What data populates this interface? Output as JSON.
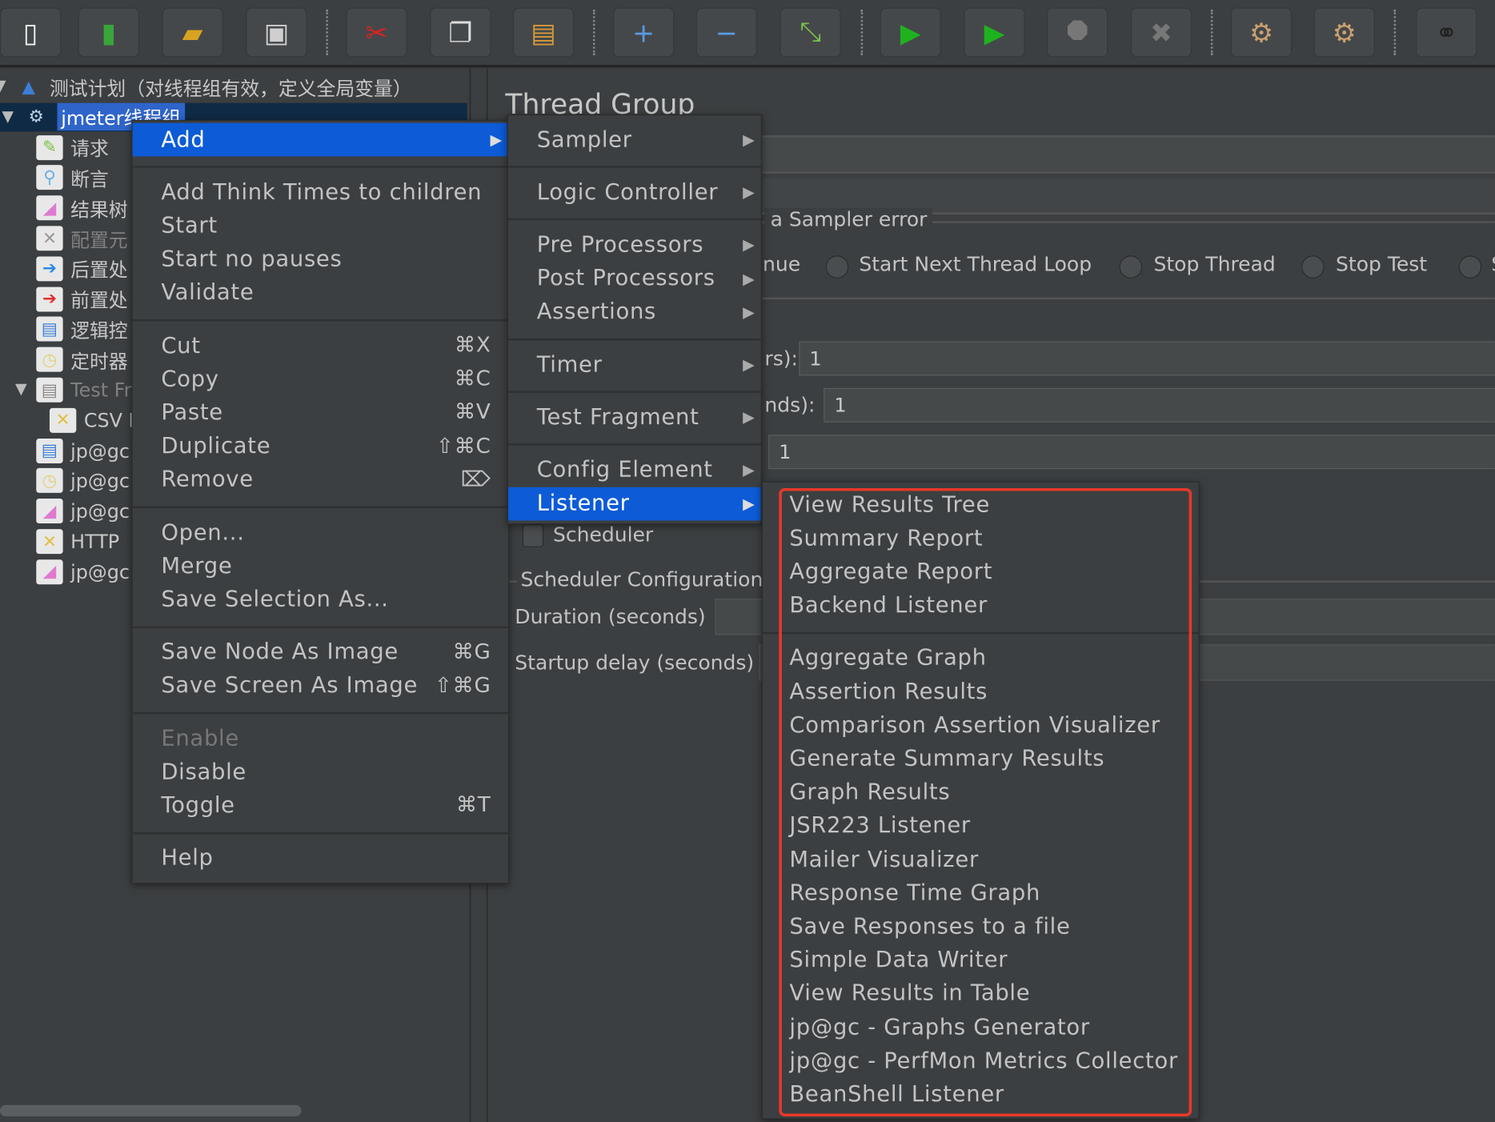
{
  "toolbar": {
    "buttons": [
      {
        "name": "new-icon",
        "glyph": "▯",
        "color": "#f0f0f0"
      },
      {
        "name": "templates-icon",
        "glyph": "▮",
        "color": "#3aa63a"
      },
      {
        "name": "open-icon",
        "glyph": "▰",
        "color": "#d9a321"
      },
      {
        "name": "save-icon",
        "glyph": "▣",
        "color": "#cfcfcf"
      },
      {
        "name": "cut-icon",
        "glyph": "✂",
        "color": "#e02020"
      },
      {
        "name": "copy-icon",
        "glyph": "❐",
        "color": "#dddddd"
      },
      {
        "name": "paste-icon",
        "glyph": "▤",
        "color": "#d59a3a"
      },
      {
        "name": "expand-all-icon",
        "glyph": "+",
        "color": "#5a9ae0"
      },
      {
        "name": "collapse-all-icon",
        "glyph": "−",
        "color": "#5a9ae0"
      },
      {
        "name": "toggle-icon",
        "glyph": "⤡",
        "color": "#7ac04a"
      },
      {
        "name": "start-icon",
        "glyph": "▶",
        "color": "#1fb21f"
      },
      {
        "name": "start-no-pauses-icon",
        "glyph": "▶",
        "color": "#1fb21f"
      },
      {
        "name": "stop-icon",
        "glyph": "⯃",
        "color": "#777777"
      },
      {
        "name": "shutdown-icon",
        "glyph": "✖",
        "color": "#777777"
      },
      {
        "name": "clear-icon",
        "glyph": "⚙",
        "color": "#c8a070"
      },
      {
        "name": "clear-all-icon",
        "glyph": "⚙",
        "color": "#c8a070"
      },
      {
        "name": "search-binoculars-icon",
        "glyph": "⚭",
        "color": "#222222"
      }
    ]
  },
  "tree": {
    "items": [
      {
        "label": "测试计划（对线程组有效，定义全局变量）",
        "icon": "test-plan-icon",
        "glyph": "▲",
        "color": "#3b7fd8"
      },
      {
        "label": "jmeter线程组",
        "icon": "thread-group-gear-icon",
        "glyph": "⚙",
        "color": "#bfd0e6"
      },
      {
        "label": "请求",
        "icon": "sampler-pen-icon",
        "glyph": "✎",
        "color": "#7bc043"
      },
      {
        "label": "断言",
        "icon": "assertion-magnifier-icon",
        "glyph": "⚲",
        "color": "#6ab0e8"
      },
      {
        "label": "结果树",
        "icon": "listener-graph-icon",
        "glyph": "◢",
        "color": "#e07ad0"
      },
      {
        "label": "配置元",
        "icon": "config-tools-icon",
        "glyph": "✕",
        "color": "#999999"
      },
      {
        "label": "后置处",
        "icon": "post-processor-icon",
        "glyph": "➔",
        "color": "#2a8ae0"
      },
      {
        "label": "前置处",
        "icon": "pre-processor-icon",
        "glyph": "➔",
        "color": "#e03030"
      },
      {
        "label": "逻辑控",
        "icon": "logic-controller-icon",
        "glyph": "▤",
        "color": "#3b7fd8"
      },
      {
        "label": "定时器",
        "icon": "timer-clock-icon",
        "glyph": "◷",
        "color": "#e0d070"
      },
      {
        "label": "Test Fr",
        "icon": "test-fragment-icon",
        "glyph": "▤",
        "color": "#888888"
      },
      {
        "label": "CSV D",
        "icon": "config-tools-icon",
        "glyph": "✕",
        "color": "#e0c040"
      },
      {
        "label": "jp@gc",
        "icon": "logic-controller-icon",
        "glyph": "▤",
        "color": "#3b7fd8"
      },
      {
        "label": "jp@gc",
        "icon": "timer-clock-icon",
        "glyph": "◷",
        "color": "#e0d070"
      },
      {
        "label": "jp@gc",
        "icon": "listener-graph-icon",
        "glyph": "◢",
        "color": "#e07ad0"
      },
      {
        "label": "HTTP",
        "icon": "config-tools-icon",
        "glyph": "✕",
        "color": "#e0c040"
      },
      {
        "label": "jp@gc",
        "icon": "listener-graph-icon",
        "glyph": "◢",
        "color": "#e07ad0"
      }
    ]
  },
  "panel": {
    "title": "Thread Group",
    "sampler_error_legend": "a Sampler error",
    "radio_continue": "nue",
    "radio_next_loop": "Start Next Thread Loop",
    "radio_stop_thread": "Stop Thread",
    "radio_stop_test": "Stop Test",
    "radio_stop_now": "S",
    "threads_label": "rs):",
    "threads_value": "1",
    "rampup_label": "nds):",
    "rampup_value": "1",
    "loop_value": "1",
    "scheduler_label": "Scheduler",
    "scheduler_config_legend": "Scheduler Configuration",
    "duration_label": "Duration (seconds)",
    "startup_delay_label": "Startup delay (seconds)"
  },
  "context_menu": {
    "items": [
      {
        "label": "Add",
        "submenu": true,
        "highlighted": true
      },
      {
        "sep": true
      },
      {
        "label": "Add Think Times to children"
      },
      {
        "label": "Start"
      },
      {
        "label": "Start no pauses"
      },
      {
        "label": "Validate"
      },
      {
        "sep": true
      },
      {
        "label": "Cut",
        "shortcut": "⌘X"
      },
      {
        "label": "Copy",
        "shortcut": "⌘C"
      },
      {
        "label": "Paste",
        "shortcut": "⌘V"
      },
      {
        "label": "Duplicate",
        "shortcut": "⇧⌘C"
      },
      {
        "label": "Remove",
        "shortcut": "⌦"
      },
      {
        "sep": true
      },
      {
        "label": "Open..."
      },
      {
        "label": "Merge"
      },
      {
        "label": "Save Selection As..."
      },
      {
        "sep": true
      },
      {
        "label": "Save Node As Image",
        "shortcut": "⌘G"
      },
      {
        "label": "Save Screen As Image",
        "shortcut": "⇧⌘G"
      },
      {
        "sep": true
      },
      {
        "label": "Enable",
        "disabled": true
      },
      {
        "label": "Disable"
      },
      {
        "label": "Toggle",
        "shortcut": "⌘T"
      },
      {
        "sep": true
      },
      {
        "label": "Help"
      }
    ]
  },
  "add_submenu": {
    "items": [
      {
        "label": "Sampler",
        "submenu": true
      },
      {
        "sep": true
      },
      {
        "label": "Logic Controller",
        "submenu": true
      },
      {
        "sep": true
      },
      {
        "label": "Pre Processors",
        "submenu": true
      },
      {
        "label": "Post Processors",
        "submenu": true
      },
      {
        "label": "Assertions",
        "submenu": true
      },
      {
        "sep": true
      },
      {
        "label": "Timer",
        "submenu": true
      },
      {
        "sep": true
      },
      {
        "label": "Test Fragment",
        "submenu": true
      },
      {
        "sep": true
      },
      {
        "label": "Config Element",
        "submenu": true
      },
      {
        "label": "Listener",
        "submenu": true,
        "highlighted": true
      }
    ]
  },
  "listener_submenu": {
    "highlight_color": "#e8372a",
    "items": [
      {
        "label": "View Results Tree"
      },
      {
        "label": "Summary Report"
      },
      {
        "label": "Aggregate Report"
      },
      {
        "label": "Backend Listener"
      },
      {
        "sep": true
      },
      {
        "label": "Aggregate Graph"
      },
      {
        "label": "Assertion Results"
      },
      {
        "label": "Comparison Assertion Visualizer"
      },
      {
        "label": "Generate Summary Results"
      },
      {
        "label": "Graph Results"
      },
      {
        "label": "JSR223 Listener"
      },
      {
        "label": "Mailer Visualizer"
      },
      {
        "label": "Response Time Graph"
      },
      {
        "label": "Save Responses to a file"
      },
      {
        "label": "Simple Data Writer"
      },
      {
        "label": "View Results in Table"
      },
      {
        "label": "jp@gc - Graphs Generator"
      },
      {
        "label": "jp@gc - PerfMon Metrics Collector"
      },
      {
        "label": "BeanShell Listener"
      }
    ]
  },
  "colors": {
    "background": "#3c3f41",
    "menu_highlight": "#0d5bd6",
    "selection_row": "#0f2a45",
    "selection_label": "#2f65ca"
  }
}
